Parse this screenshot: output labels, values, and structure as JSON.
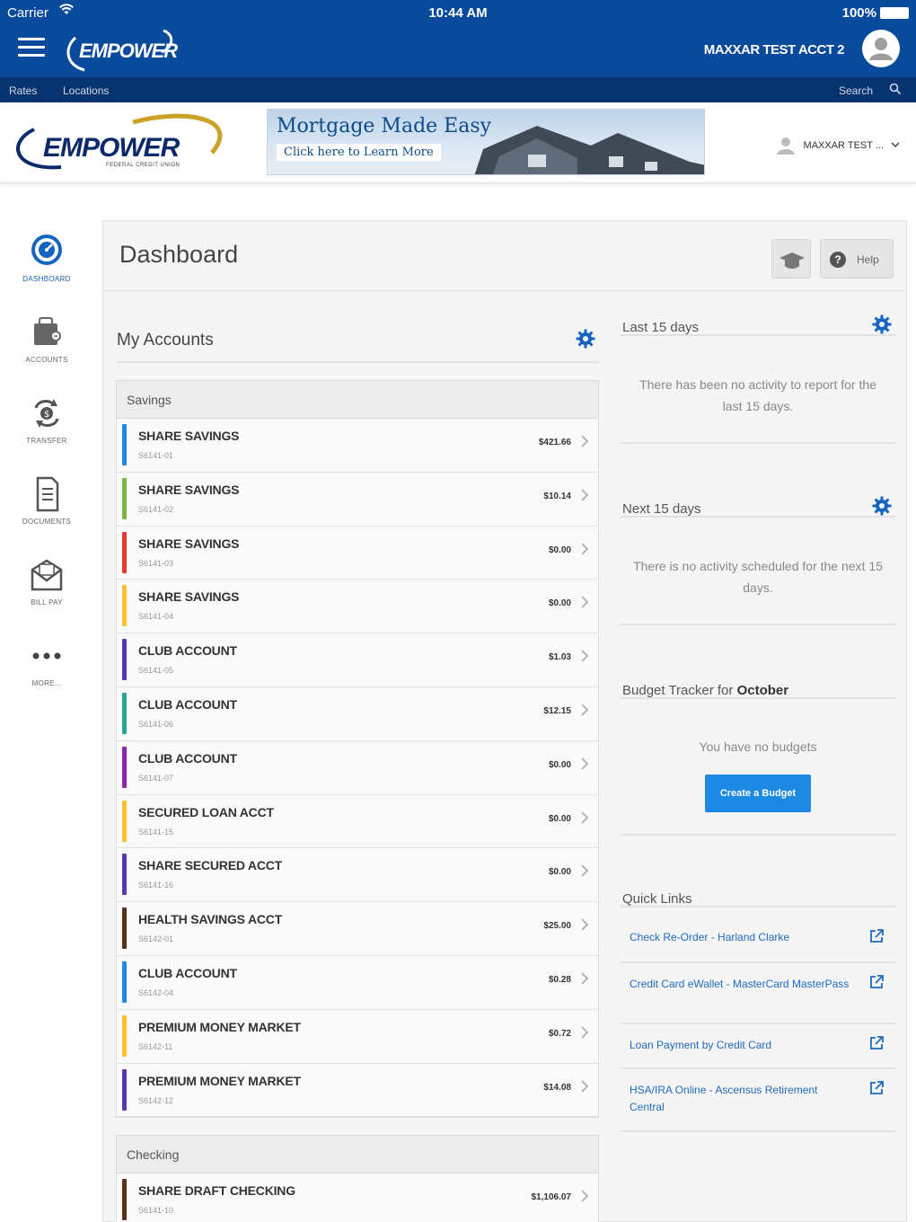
{
  "status_bar": {
    "carrier": "Carrier",
    "time": "10:44 AM",
    "battery": "100%"
  },
  "app_header": {
    "logo": "EMPOWER",
    "account_name": "MAXXAR TEST ACCT 2",
    "nav": {
      "rates": "Rates",
      "locations": "Locations",
      "search": "Search"
    }
  },
  "site_header": {
    "logo": "EMPOWER",
    "logo_sub": "FEDERAL CREDIT UNION",
    "banner": {
      "headline": "Mortgage Made Easy",
      "cta": "Click here to Learn More"
    },
    "user_menu": "MAXXAR TEST ..."
  },
  "sidebar": {
    "items": [
      {
        "label": "DASHBOARD",
        "icon": "dashboard-icon"
      },
      {
        "label": "ACCOUNTS",
        "icon": "wallet-icon"
      },
      {
        "label": "TRANSFER",
        "icon": "transfer-icon"
      },
      {
        "label": "DOCUMENTS",
        "icon": "document-icon"
      },
      {
        "label": "BILL PAY",
        "icon": "bill-pay-icon"
      },
      {
        "label": "MORE...",
        "icon": "more-icon"
      }
    ]
  },
  "dashboard": {
    "title": "Dashboard",
    "help_label": "Help",
    "my_accounts": {
      "title": "My Accounts",
      "groups": [
        {
          "name": "Savings",
          "accounts": [
            {
              "name": "SHARE SAVINGS",
              "number": "S6141-01",
              "balance": "$421.66",
              "color": "#1e88e5"
            },
            {
              "name": "SHARE SAVINGS",
              "number": "S6141-02",
              "balance": "$10.14",
              "color": "#7cb342"
            },
            {
              "name": "SHARE SAVINGS",
              "number": "S6141-03",
              "balance": "$0.00",
              "color": "#e53935"
            },
            {
              "name": "SHARE SAVINGS",
              "number": "S6141-04",
              "balance": "$0.00",
              "color": "#fbc02d"
            },
            {
              "name": "CLUB ACCOUNT",
              "number": "S6141-05",
              "balance": "$1.03",
              "color": "#5e35b1"
            },
            {
              "name": "CLUB ACCOUNT",
              "number": "S6141-06",
              "balance": "$12.15",
              "color": "#26a69a"
            },
            {
              "name": "CLUB ACCOUNT",
              "number": "S6141-07",
              "balance": "$0.00",
              "color": "#8e24aa"
            },
            {
              "name": "SECURED LOAN ACCT",
              "number": "S6141-15",
              "balance": "$0.00",
              "color": "#fbc02d"
            },
            {
              "name": "SHARE SECURED ACCT",
              "number": "S6141-16",
              "balance": "$0.00",
              "color": "#5e35b1"
            },
            {
              "name": "HEALTH SAVINGS ACCT",
              "number": "S6142-01",
              "balance": "$25.00",
              "color": "#5d2e17"
            },
            {
              "name": "CLUB ACCOUNT",
              "number": "S6142-04",
              "balance": "$0.28",
              "color": "#1e88e5"
            },
            {
              "name": "PREMIUM MONEY MARKET",
              "number": "S6142-11",
              "balance": "$0.72",
              "color": "#fbc02d"
            },
            {
              "name": "PREMIUM MONEY MARKET",
              "number": "S6142-12",
              "balance": "$14.08",
              "color": "#5e35b1"
            }
          ]
        },
        {
          "name": "Checking",
          "accounts": [
            {
              "name": "SHARE DRAFT CHECKING",
              "number": "S6141-10",
              "balance": "$1,106.07",
              "color": "#5d2e17"
            }
          ]
        }
      ]
    },
    "last15": {
      "title": "Last 15 days",
      "message": "There has been no activity to report for the last 15 days."
    },
    "next15": {
      "title": "Next 15 days",
      "message": "There is no activity scheduled for the next 15 days."
    },
    "budget": {
      "title_prefix": "Budget Tracker for ",
      "month": "October",
      "message": "You have no budgets",
      "button": "Create a Budget"
    },
    "quick_links": {
      "title": "Quick Links",
      "links": [
        "Check Re-Order - Harland Clarke",
        "Credit Card eWallet - MasterCard MasterPass",
        "Loan Payment by Credit Card",
        "HSA/IRA Online - Ascensus Retirement Central"
      ]
    }
  }
}
